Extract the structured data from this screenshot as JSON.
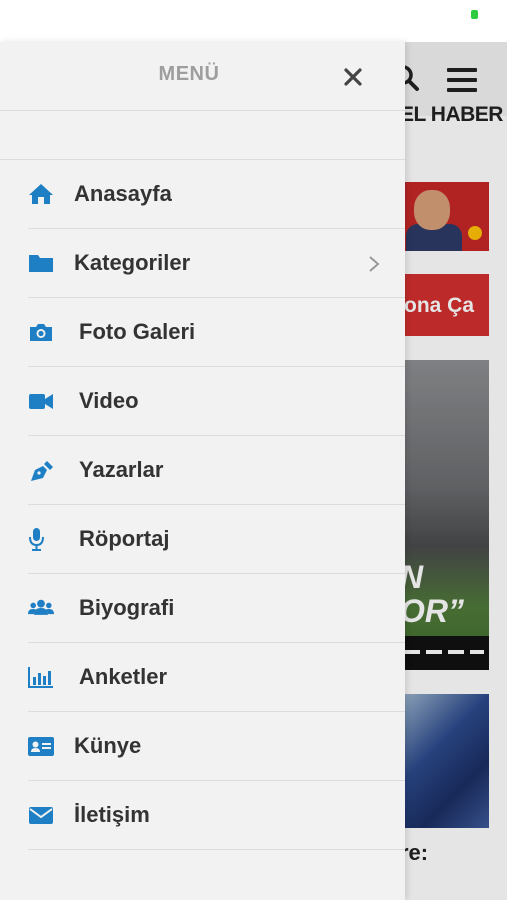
{
  "drawer": {
    "title": "MENÜ",
    "items": [
      {
        "label": "Anasayfa",
        "icon": "home-icon"
      },
      {
        "label": "Kategoriler",
        "icon": "folder-icon",
        "has_submenu": true
      },
      {
        "label": "Foto Galeri",
        "icon": "camera-icon"
      },
      {
        "label": "Video",
        "icon": "video-camera-icon"
      },
      {
        "label": "Yazarlar",
        "icon": "pen-icon"
      },
      {
        "label": "Röportaj",
        "icon": "microphone-icon"
      },
      {
        "label": "Biyografi",
        "icon": "users-icon"
      },
      {
        "label": "Anketler",
        "icon": "bar-chart-icon"
      },
      {
        "label": "Künye",
        "icon": "id-card-icon"
      },
      {
        "label": "İletişim",
        "icon": "envelope-icon"
      }
    ]
  },
  "background": {
    "strip_label": "EL HABER",
    "banner_text": "ona Ça",
    "photo_caption": "N\nOR”",
    "bottom_text": "re:"
  },
  "colors": {
    "accent": "#1f7fc4",
    "drawer_bg": "#f2f2f2",
    "label": "#333333",
    "title": "#9e9e9e"
  }
}
